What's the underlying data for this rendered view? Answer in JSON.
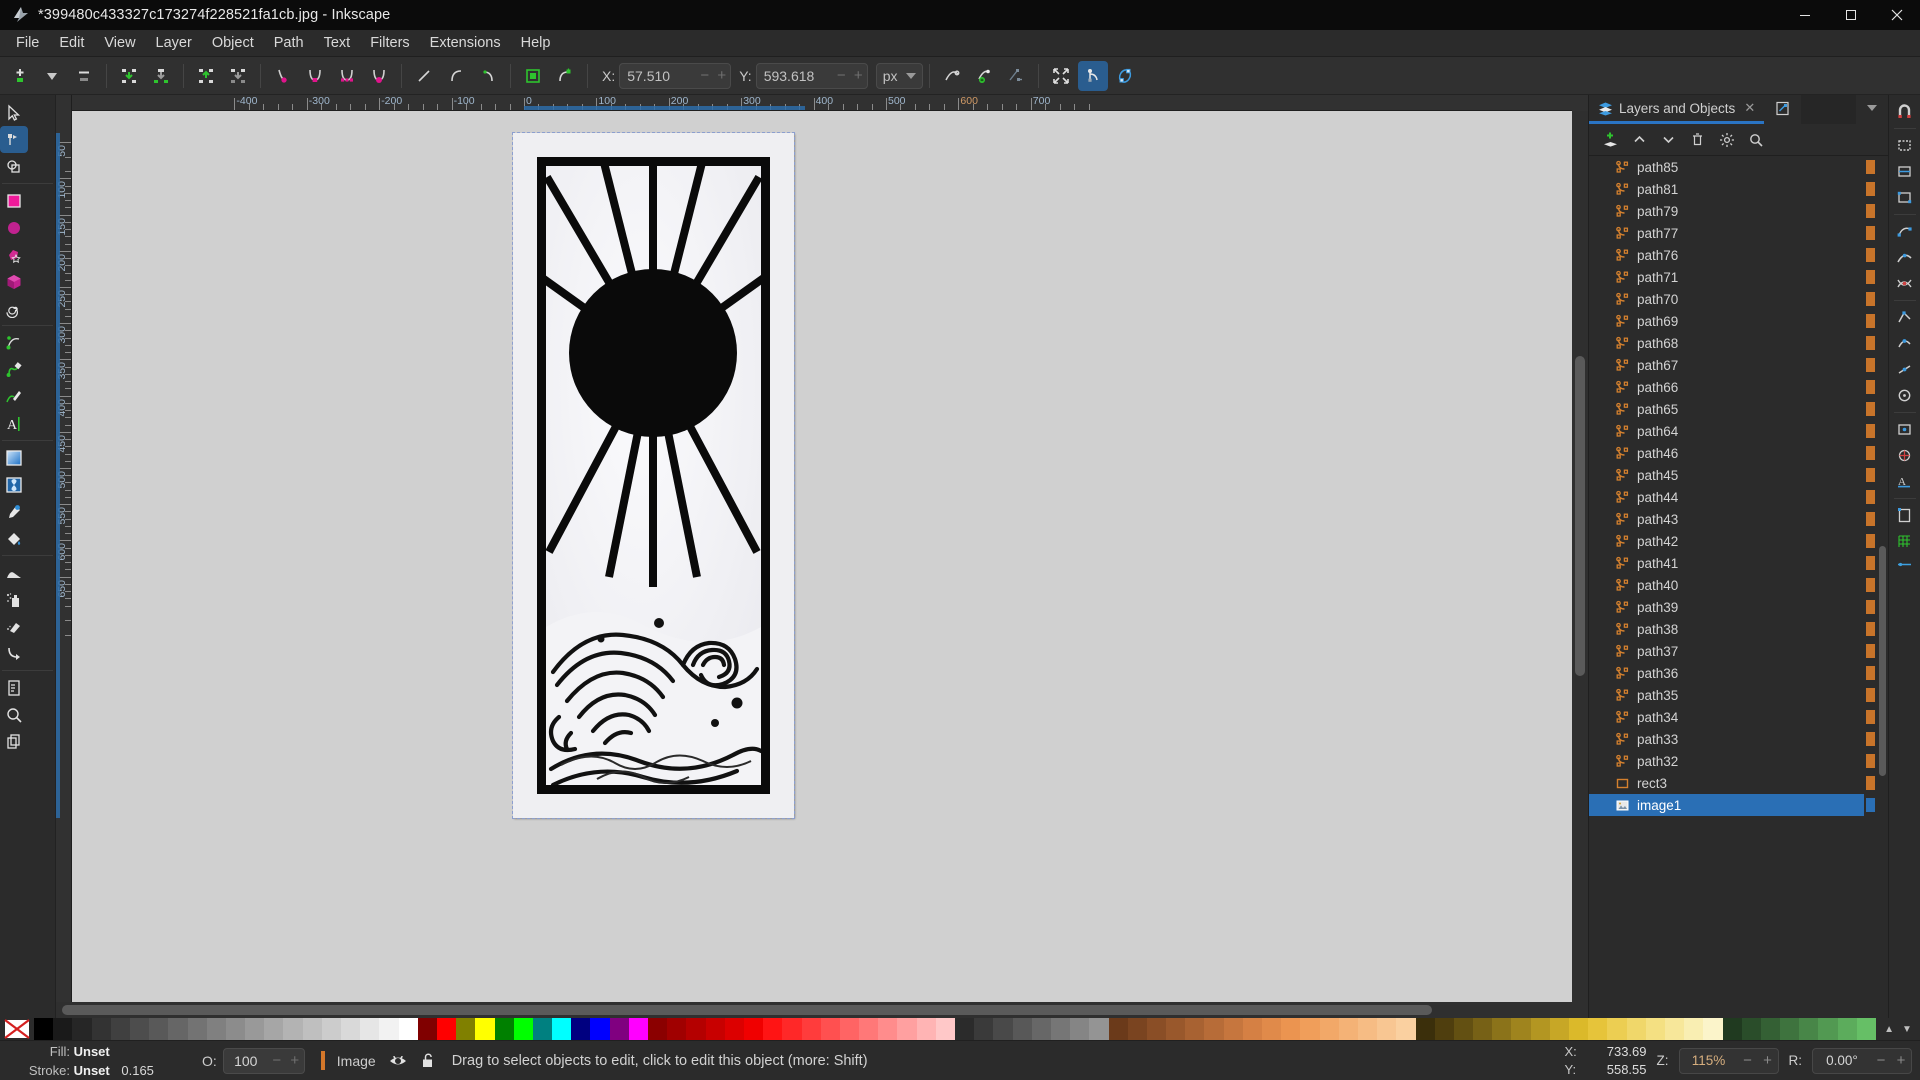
{
  "window": {
    "title": "*399480c433327c173274f228521fa1cb.jpg - Inkscape",
    "logo_icon": "inkscape-logo-icon",
    "minimize_label": "–",
    "maximize_label": "☐",
    "close_label": "✕"
  },
  "menubar": {
    "items": [
      {
        "label": "File"
      },
      {
        "label": "Edit"
      },
      {
        "label": "View"
      },
      {
        "label": "Layer"
      },
      {
        "label": "Object"
      },
      {
        "label": "Path"
      },
      {
        "label": "Text"
      },
      {
        "label": "Filters"
      },
      {
        "label": "Extensions"
      },
      {
        "label": "Help"
      }
    ]
  },
  "node_toolbar": {
    "buttons": [
      {
        "name": "insert-node-icon",
        "tip": "Insert new nodes into selected segments"
      },
      {
        "name": "insert-node-dropdown-icon",
        "tip": "Insert node options"
      },
      {
        "name": "delete-node-icon",
        "tip": "Delete selected nodes"
      },
      {
        "name": "break-path-icon",
        "tip": "Break path at selected nodes"
      },
      {
        "name": "join-nodes-icon",
        "tip": "Join selected nodes"
      },
      {
        "name": "join-segment-icon",
        "tip": "Join selected endnodes with a new segment"
      },
      {
        "name": "delete-segment-icon",
        "tip": "Delete segment between two non-endpoint nodes"
      },
      {
        "name": "node-cusp-icon",
        "tip": "Make selected nodes corner"
      },
      {
        "name": "node-smooth-icon",
        "tip": "Make selected nodes smooth"
      },
      {
        "name": "node-symmetric-icon",
        "tip": "Make selected nodes symmetric"
      },
      {
        "name": "node-auto-icon",
        "tip": "Make selected nodes auto-smooth"
      },
      {
        "name": "node-line-icon",
        "tip": "Make selected segments lines"
      },
      {
        "name": "node-curve-icon",
        "tip": "Make selected segments curves"
      },
      {
        "name": "object-to-path-icon",
        "tip": "Convert object to path"
      },
      {
        "name": "stroke-to-path-icon",
        "tip": "Convert stroke to path"
      },
      {
        "name": "show-transform-handles-icon",
        "tip": "Show transformation handles"
      },
      {
        "name": "show-path-outline-icon",
        "tip": "Show path outline"
      }
    ],
    "x_label": "X:",
    "x_value": "57.510",
    "y_label": "Y:",
    "y_value": "593.618",
    "unit_value": "px",
    "minus_label": "−",
    "plus_label": "+",
    "right_buttons": [
      {
        "name": "edit-clip-path-icon",
        "tip": "Edit clipping path"
      },
      {
        "name": "edit-mask-icon",
        "tip": "Edit mask path"
      },
      {
        "name": "show-helper-path-icon",
        "tip": "Show path outline"
      },
      {
        "name": "expand-nodes-icon",
        "tip": "Show transform handles"
      },
      {
        "name": "show-node-handles-icon",
        "tip": "Show Bezier handles of selected nodes",
        "active": true
      },
      {
        "name": "show-outline-icon",
        "tip": "Show outline of the path"
      }
    ]
  },
  "toolbox": {
    "tools": [
      {
        "name": "selector-tool",
        "icon": "arrow-cursor-icon",
        "active": false
      },
      {
        "name": "node-tool",
        "icon": "node-editor-icon",
        "active": true
      },
      {
        "name": "boolean-tool",
        "icon": "boolean-shapes-icon",
        "active": false
      },
      {
        "name": "rectangle-tool",
        "icon": "square-icon",
        "active": false
      },
      {
        "name": "ellipse-tool",
        "icon": "circle-icon",
        "active": false
      },
      {
        "name": "star-tool",
        "icon": "star-icon",
        "active": false
      },
      {
        "name": "box3d-tool",
        "icon": "cube-icon",
        "active": false
      },
      {
        "name": "spiral-tool",
        "icon": "spiral-icon",
        "active": false
      },
      {
        "name": "pencil-tool",
        "icon": "pencil-freehand-icon",
        "active": false
      },
      {
        "name": "bezier-tool",
        "icon": "bezier-pen-icon",
        "active": false
      },
      {
        "name": "calligraphy-tool",
        "icon": "calligraphy-brush-icon",
        "active": false
      },
      {
        "name": "text-tool",
        "icon": "text-a-icon",
        "active": false
      },
      {
        "name": "gradient-tool",
        "icon": "gradient-icon",
        "active": false
      },
      {
        "name": "mesh-tool",
        "icon": "mesh-gradient-icon",
        "active": false
      },
      {
        "name": "dropper-tool",
        "icon": "eyedropper-icon",
        "active": false
      },
      {
        "name": "paintbucket-tool",
        "icon": "paint-bucket-icon",
        "active": false
      },
      {
        "name": "tweak-tool",
        "icon": "tweak-icon",
        "active": false
      },
      {
        "name": "spray-tool",
        "icon": "spray-can-icon",
        "active": false
      },
      {
        "name": "eraser-tool",
        "icon": "eraser-icon",
        "active": false
      },
      {
        "name": "connector-tool",
        "icon": "connector-arrow-icon",
        "active": false
      },
      {
        "name": "pages-tool",
        "icon": "page-icon",
        "active": false
      },
      {
        "name": "zoom-tool",
        "icon": "magnifier-icon",
        "active": false
      },
      {
        "name": "measure-tool",
        "icon": "copy-pages-icon",
        "active": false
      }
    ]
  },
  "rulers": {
    "horizontal": [
      "-400",
      "-300",
      "-200",
      "-100",
      "0",
      "100",
      "200",
      "300",
      "400",
      "500",
      "600",
      "700"
    ],
    "vertical": [
      "50",
      "100",
      "150",
      "200",
      "250",
      "300",
      "350",
      "400",
      "450",
      "500",
      "550",
      "600",
      "650"
    ]
  },
  "canvas": {
    "artwork_description": "black-and-white woodcut of a sun with rays over a cresting ocean wave in a tall rectangular frame"
  },
  "right_panel": {
    "tabs": [
      {
        "label": "Layers and Objects",
        "icon": "layers-icon",
        "closable": true,
        "active": true
      },
      {
        "label": "",
        "icon": "xml-editor-icon",
        "closable": false,
        "active": false
      }
    ],
    "tab_close_label": "✕",
    "menu_caret": "▼",
    "toolbar": [
      {
        "name": "add-layer-button",
        "icon": "add-layer-icon"
      },
      {
        "name": "move-up-button",
        "icon": "chevron-up-icon"
      },
      {
        "name": "move-down-button",
        "icon": "chevron-down-icon"
      },
      {
        "name": "delete-layer-button",
        "icon": "trash-icon"
      },
      {
        "name": "layer-settings-button",
        "icon": "gear-icon"
      },
      {
        "name": "search-layers-button",
        "icon": "search-icon"
      }
    ],
    "items": [
      {
        "label": "path85",
        "icon": "path-icon",
        "selected": false
      },
      {
        "label": "path81",
        "icon": "path-icon",
        "selected": false
      },
      {
        "label": "path79",
        "icon": "path-icon",
        "selected": false
      },
      {
        "label": "path77",
        "icon": "path-icon",
        "selected": false
      },
      {
        "label": "path76",
        "icon": "path-icon",
        "selected": false
      },
      {
        "label": "path71",
        "icon": "path-icon",
        "selected": false
      },
      {
        "label": "path70",
        "icon": "path-icon",
        "selected": false
      },
      {
        "label": "path69",
        "icon": "path-icon",
        "selected": false
      },
      {
        "label": "path68",
        "icon": "path-icon",
        "selected": false
      },
      {
        "label": "path67",
        "icon": "path-icon",
        "selected": false
      },
      {
        "label": "path66",
        "icon": "path-icon",
        "selected": false
      },
      {
        "label": "path65",
        "icon": "path-icon",
        "selected": false
      },
      {
        "label": "path64",
        "icon": "path-icon",
        "selected": false
      },
      {
        "label": "path46",
        "icon": "path-icon",
        "selected": false
      },
      {
        "label": "path45",
        "icon": "path-icon",
        "selected": false
      },
      {
        "label": "path44",
        "icon": "path-icon",
        "selected": false
      },
      {
        "label": "path43",
        "icon": "path-icon",
        "selected": false
      },
      {
        "label": "path42",
        "icon": "path-icon",
        "selected": false
      },
      {
        "label": "path41",
        "icon": "path-icon",
        "selected": false
      },
      {
        "label": "path40",
        "icon": "path-icon",
        "selected": false
      },
      {
        "label": "path39",
        "icon": "path-icon",
        "selected": false
      },
      {
        "label": "path38",
        "icon": "path-icon",
        "selected": false
      },
      {
        "label": "path37",
        "icon": "path-icon",
        "selected": false
      },
      {
        "label": "path36",
        "icon": "path-icon",
        "selected": false
      },
      {
        "label": "path35",
        "icon": "path-icon",
        "selected": false
      },
      {
        "label": "path34",
        "icon": "path-icon",
        "selected": false
      },
      {
        "label": "path33",
        "icon": "path-icon",
        "selected": false
      },
      {
        "label": "path32",
        "icon": "path-icon",
        "selected": false
      },
      {
        "label": "rect3",
        "icon": "rect-icon",
        "selected": false
      },
      {
        "label": "image1",
        "icon": "image-icon",
        "selected": true
      }
    ]
  },
  "snap_bar": {
    "buttons": [
      {
        "name": "snap-master-toggle",
        "icon": "magnet-icon"
      },
      {
        "name": "snap-bounding-box",
        "icon": "bbox-icon"
      },
      {
        "name": "snap-bbox-edges",
        "icon": "bbox-edge-icon"
      },
      {
        "name": "snap-bbox-corners",
        "icon": "bbox-corner-icon"
      },
      {
        "name": "snap-nodes",
        "icon": "node-snap-icon"
      },
      {
        "name": "snap-paths",
        "icon": "path-snap-icon"
      },
      {
        "name": "snap-path-intersections",
        "icon": "path-intersection-icon"
      },
      {
        "name": "snap-cusp-nodes",
        "icon": "cusp-node-icon"
      },
      {
        "name": "snap-smooth-nodes",
        "icon": "smooth-node-icon"
      },
      {
        "name": "snap-midpoints",
        "icon": "midpoint-icon"
      },
      {
        "name": "snap-others",
        "icon": "others-snap-icon"
      },
      {
        "name": "snap-object-centers",
        "icon": "object-center-icon"
      },
      {
        "name": "snap-rotation-centers",
        "icon": "rotation-center-icon"
      },
      {
        "name": "snap-text-baseline",
        "icon": "text-baseline-icon"
      },
      {
        "name": "snap-page-border",
        "icon": "page-border-icon"
      },
      {
        "name": "snap-grids",
        "icon": "grid-icon"
      },
      {
        "name": "snap-guides",
        "icon": "guide-icon"
      }
    ]
  },
  "palette": {
    "x_icon": "no-color-icon",
    "prev_arrow": "▲",
    "next_arrow": "▼",
    "colors": [
      "#000000",
      "#1a1a1a",
      "#262626",
      "#333333",
      "#404040",
      "#4d4d4d",
      "#595959",
      "#666666",
      "#737373",
      "#808080",
      "#8c8c8c",
      "#999999",
      "#a6a6a6",
      "#b3b3b3",
      "#bfbfbf",
      "#cccccc",
      "#d9d9d9",
      "#e6e6e6",
      "#f2f2f2",
      "#ffffff",
      "#800000",
      "#ff0000",
      "#808000",
      "#ffff00",
      "#008000",
      "#00ff00",
      "#008080",
      "#00ffff",
      "#000080",
      "#0000ff",
      "#800080",
      "#ff00ff",
      "#8b0000",
      "#a00000",
      "#b40000",
      "#c80000",
      "#dc0000",
      "#f00000",
      "#ff1414",
      "#ff2828",
      "#ff3c3c",
      "#ff5050",
      "#ff6464",
      "#ff7878",
      "#ff8c8c",
      "#ffa0a0",
      "#ffb4b4",
      "#ffc8c8",
      "#2b2b2b",
      "#3a3a3a",
      "#494949",
      "#585858",
      "#676767",
      "#767676",
      "#858585",
      "#949494",
      "#6b3a1a",
      "#7a4420",
      "#8a4e26",
      "#99582c",
      "#a86232",
      "#b76c38",
      "#c6763e",
      "#d58044",
      "#e08a4a",
      "#eb9450",
      "#f09e5a",
      "#f2a868",
      "#f4b276",
      "#f6bc84",
      "#f8c692",
      "#fad0a0",
      "#3b2f0b",
      "#4f3e0e",
      "#635012",
      "#776116",
      "#8b731a",
      "#9f841e",
      "#b39622",
      "#c7a726",
      "#dbb92a",
      "#e6c43a",
      "#ecce52",
      "#f0d76a",
      "#f4e082",
      "#f7e79a",
      "#f9eeb2",
      "#fbf4ca",
      "#203a20",
      "#2a4d2a",
      "#346034",
      "#3e733e",
      "#488648",
      "#529952",
      "#5cac5c",
      "#66bf66"
    ]
  },
  "statusbar": {
    "fill_key": "Fill:",
    "fill_value": "Unset",
    "stroke_key": "Stroke:",
    "stroke_value": "Unset",
    "stroke_width": "0.165",
    "opacity_key": "O:",
    "opacity_value": "100",
    "opacity_minus": "−",
    "opacity_plus": "+",
    "layer_name": "Image",
    "visibility_icon": "eye-icon",
    "lock_icon": "unlocked-icon",
    "message": "Drag to select objects to edit, click to edit this object (more: Shift)",
    "x_key": "X:",
    "x_value": "733.69",
    "y_key": "Y:",
    "y_value": "558.55",
    "zoom_key": "Z:",
    "zoom_value": "115%",
    "zoom_minus": "−",
    "zoom_plus": "+",
    "rotation_key": "R:",
    "rotation_value": "0.00°",
    "rotation_minus": "−",
    "rotation_plus": "+"
  }
}
